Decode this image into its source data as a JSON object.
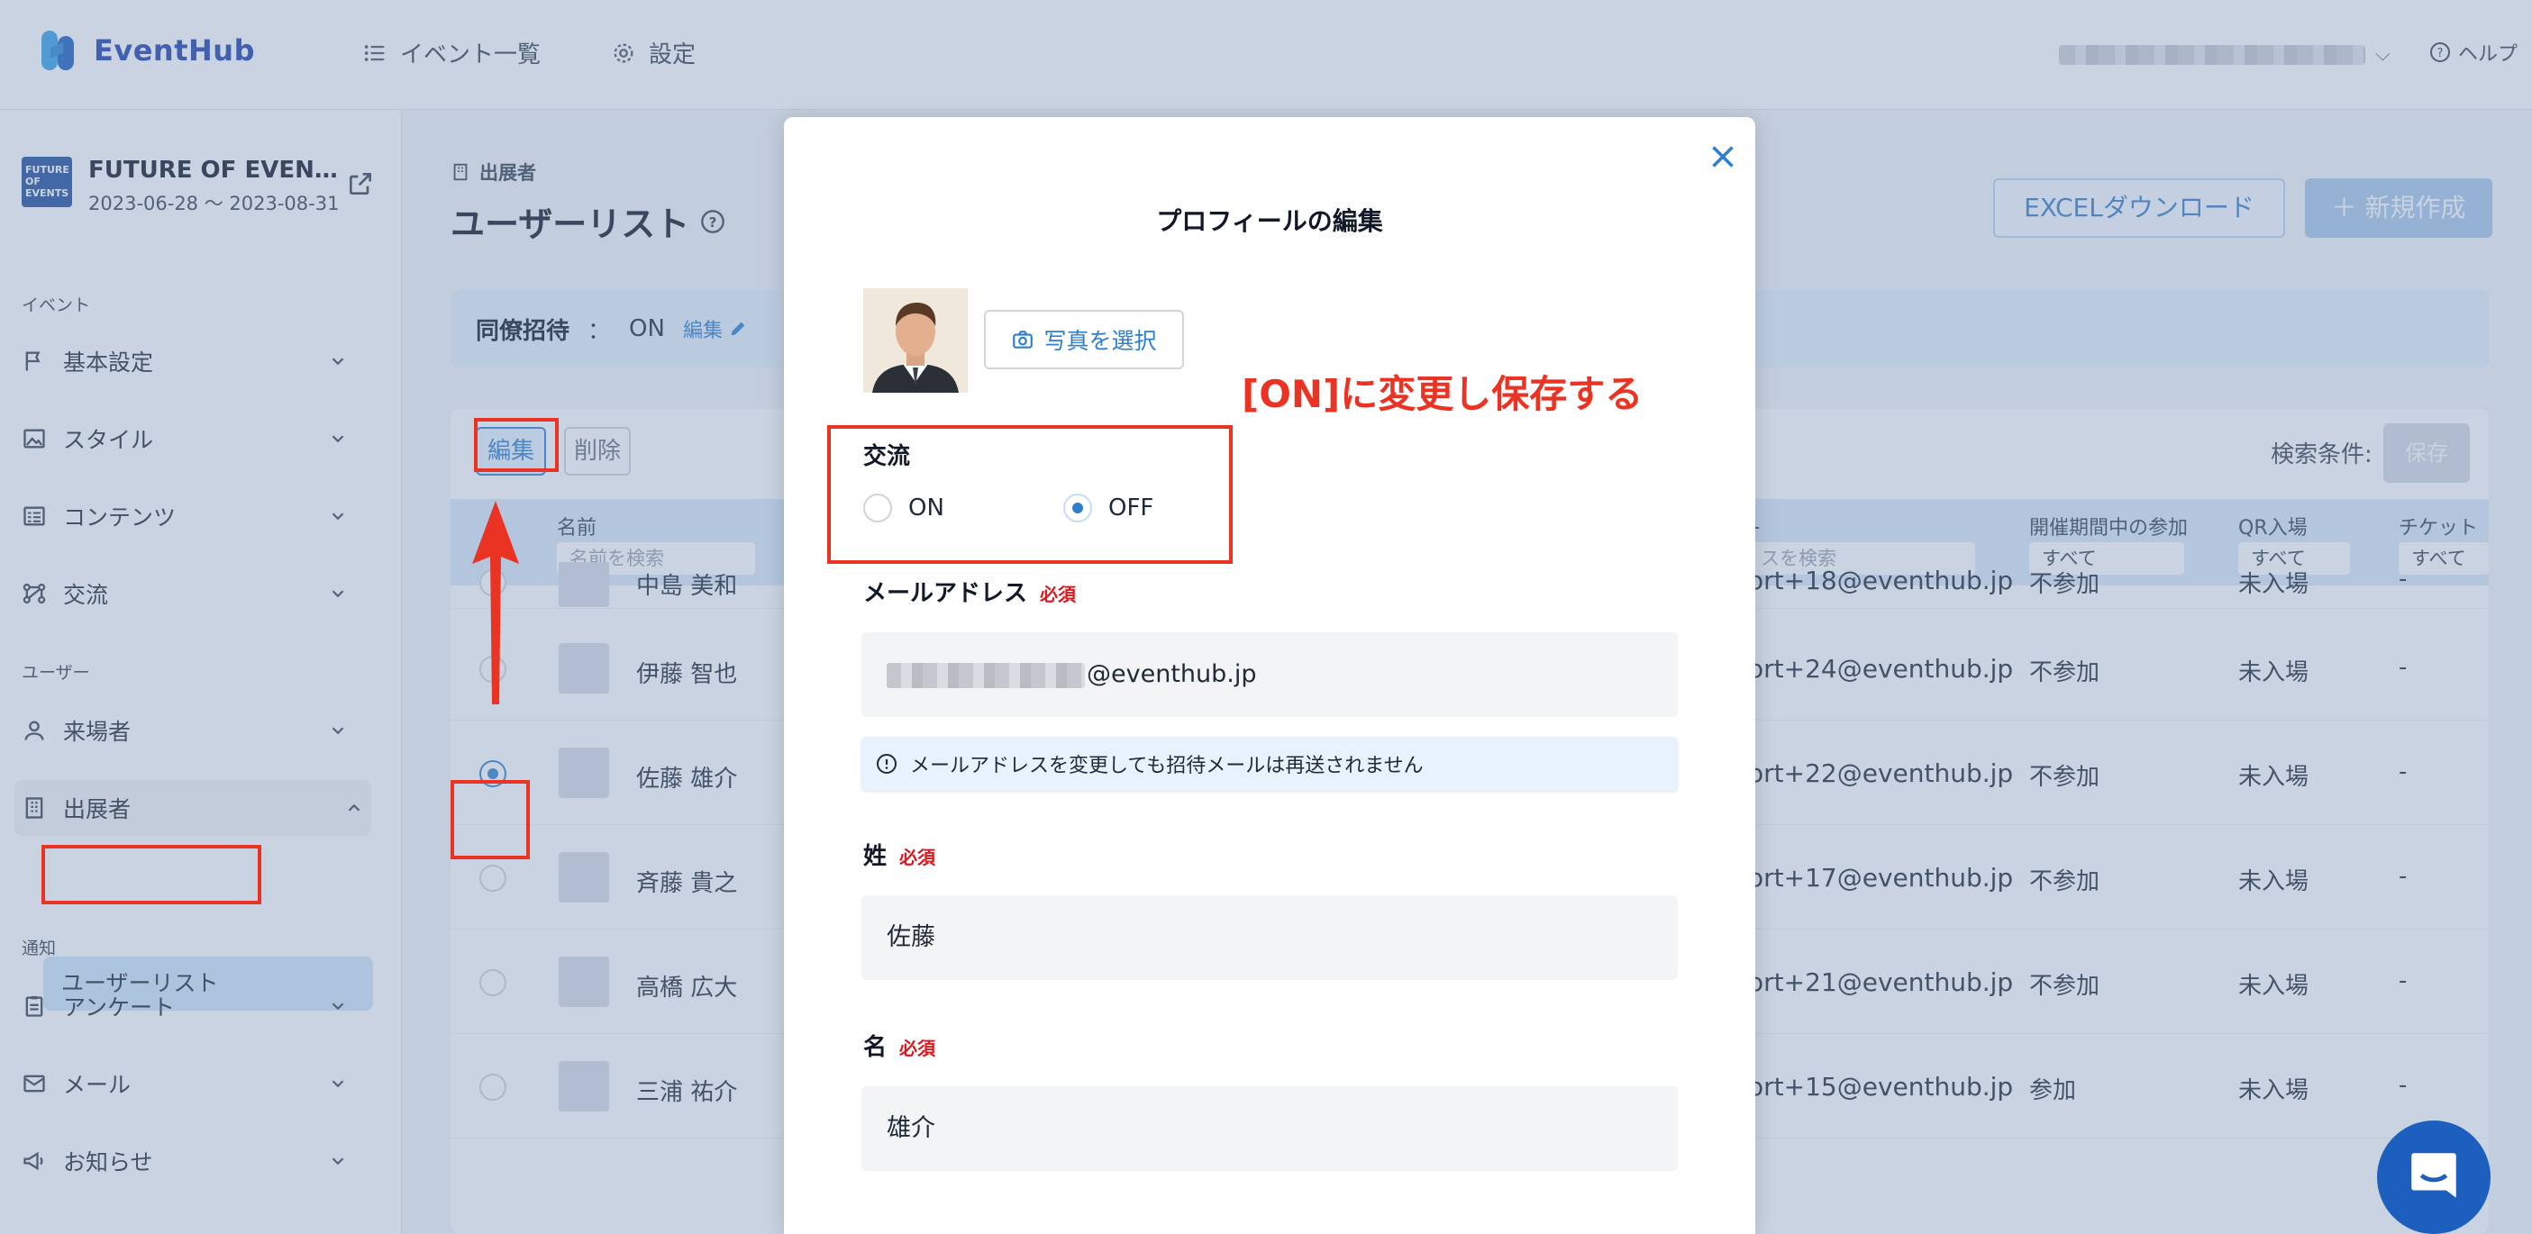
{
  "header": {
    "logo_text": "EventHub",
    "nav": [
      {
        "label": "イベント一覧",
        "icon": "list-icon"
      },
      {
        "label": "設定",
        "icon": "gear-icon"
      }
    ],
    "help_label": "ヘルプ"
  },
  "sidebar": {
    "event": {
      "thumb_text": "FUTURE OF EVENTS",
      "title": "FUTURE OF EVEN…",
      "dates": "2023-06-28 〜 2023-08-31"
    },
    "sections": {
      "event": "イベント",
      "user": "ユーザー",
      "notify": "通知"
    },
    "items": [
      {
        "label": "基本設定",
        "icon": "flag-icon"
      },
      {
        "label": "スタイル",
        "icon": "image-icon"
      },
      {
        "label": "コンテンツ",
        "icon": "content-icon"
      },
      {
        "label": "交流",
        "icon": "network-icon"
      },
      {
        "label": "来場者",
        "icon": "person-icon"
      },
      {
        "label": "出展者",
        "icon": "building-icon"
      },
      {
        "label": "アンケート",
        "icon": "clipboard-icon"
      },
      {
        "label": "メール",
        "icon": "mail-icon"
      },
      {
        "label": "お知らせ",
        "icon": "megaphone-icon"
      }
    ],
    "sub_item": "ユーザーリスト"
  },
  "main": {
    "breadcrumb": "出展者",
    "title": "ユーザーリスト",
    "excel_button": "EXCELダウンロード",
    "new_button": "＋ 新規作成",
    "invite": {
      "label": "同僚招待",
      "colon": "：",
      "value": "ON",
      "edit": "編集"
    },
    "toolbar": {
      "edit": "編集",
      "delete": "削除",
      "search_cond": "検索条件:",
      "save": "保存"
    },
    "columns": {
      "name": "名前",
      "name_placeholder": "名前を検索",
      "email_suffix": "L",
      "email_placeholder": "スを検索",
      "participation": "開催期間中の参加",
      "qr": "QR入場",
      "ticket": "チケット種",
      "all": "すべて"
    },
    "rows": [
      {
        "name": "中島 美和",
        "email": "ort+18@eventhub.jp",
        "participation": "不参加",
        "qr": "未入場",
        "ticket": "-"
      },
      {
        "name": "伊藤 智也",
        "email": "ort+24@eventhub.jp",
        "participation": "不参加",
        "qr": "未入場",
        "ticket": "-"
      },
      {
        "name": "佐藤 雄介",
        "email": "ort+22@eventhub.jp",
        "participation": "不参加",
        "qr": "未入場",
        "ticket": "-"
      },
      {
        "name": "斉藤 貴之",
        "email": "ort+17@eventhub.jp",
        "participation": "不参加",
        "qr": "未入場",
        "ticket": "-"
      },
      {
        "name": "高橋 広大",
        "email": "ort+21@eventhub.jp",
        "participation": "不参加",
        "qr": "未入場",
        "ticket": "-"
      },
      {
        "name": "三浦 祐介",
        "email": "ort+15@eventhub.jp",
        "participation": "参加",
        "qr": "未入場",
        "ticket": "-"
      }
    ]
  },
  "modal": {
    "title": "プロフィールの編集",
    "photo_button": "写真を選択",
    "exchange": {
      "label": "交流",
      "on": "ON",
      "off": "OFF",
      "selected": "OFF"
    },
    "email": {
      "label": "メールアドレス",
      "required": "必須",
      "value_suffix": "@eventhub.jp"
    },
    "notice": "メールアドレスを変更しても招待メールは再送されません",
    "last_name": {
      "label": "姓",
      "required": "必須",
      "value": "佐藤"
    },
    "first_name": {
      "label": "名",
      "required": "必須",
      "value": "雄介"
    }
  },
  "annotation": {
    "text": "[ON]に変更し保存する"
  },
  "colors": {
    "brand": "#1d5fbf",
    "accent": "#2f7fd1",
    "annotation": "#ea3323",
    "required": "#d71920"
  }
}
